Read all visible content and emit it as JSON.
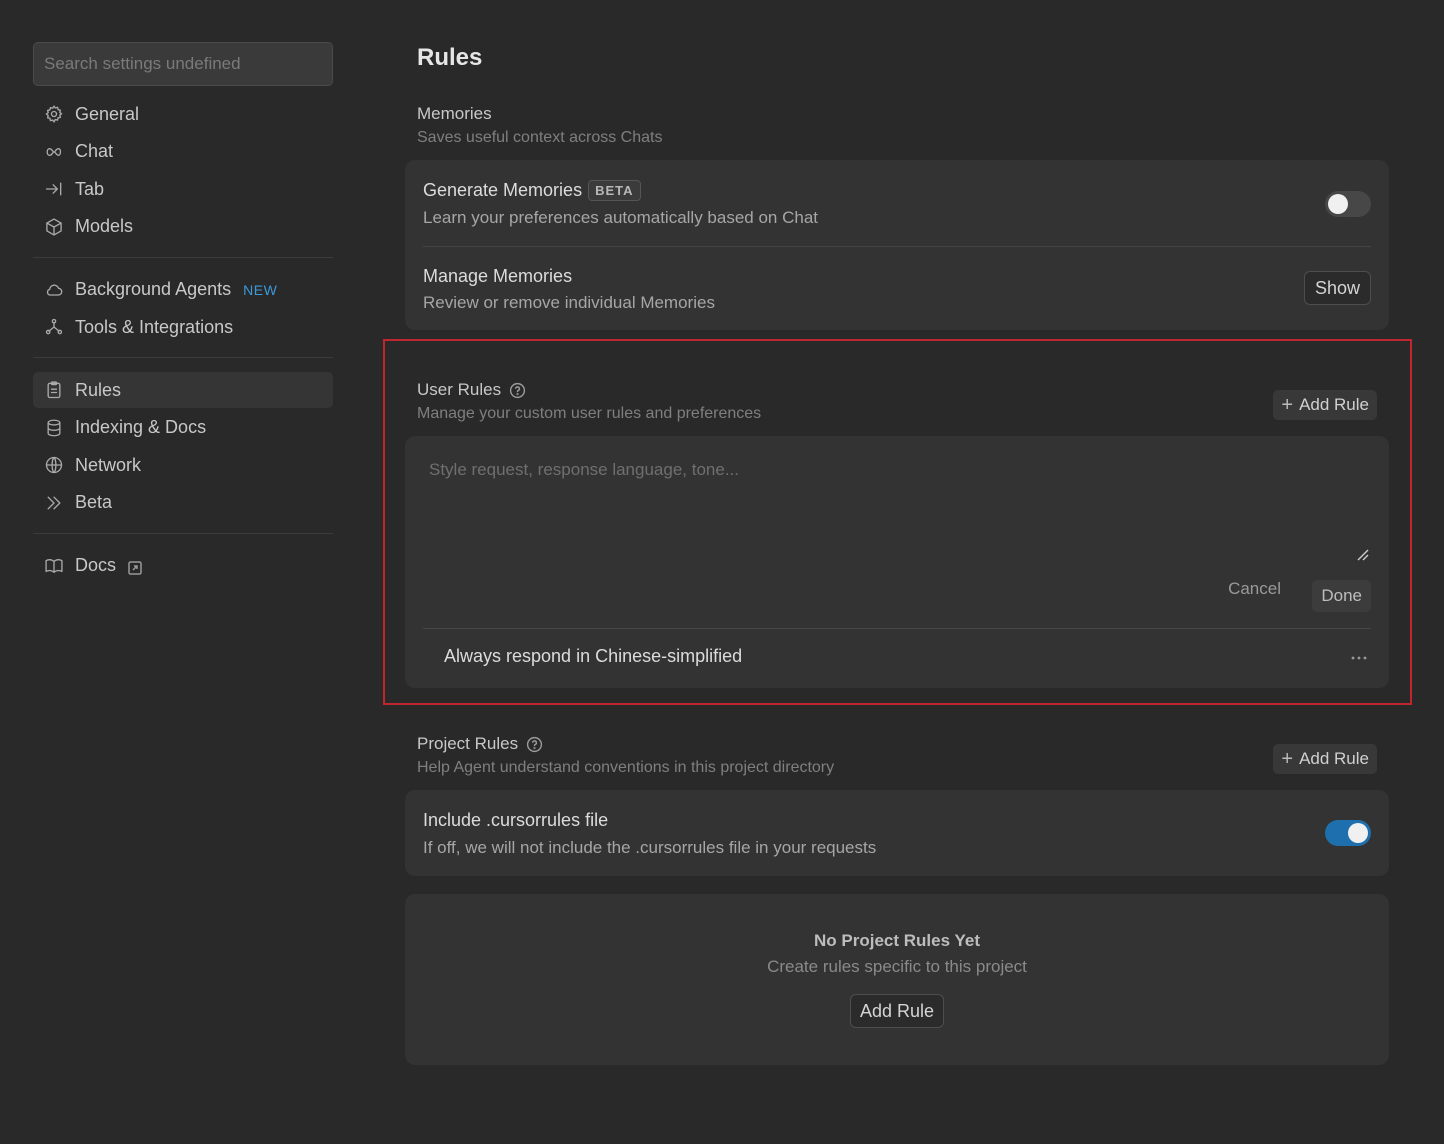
{
  "sidebar": {
    "search_placeholder": "Search settings undefined",
    "groups": [
      [
        {
          "label": "General",
          "icon": "gear-icon"
        },
        {
          "label": "Chat",
          "icon": "infinity-icon"
        },
        {
          "label": "Tab",
          "icon": "arrow-right-to-bar-icon"
        },
        {
          "label": "Models",
          "icon": "cube-icon"
        }
      ],
      [
        {
          "label": "Background Agents",
          "icon": "cloud-icon",
          "badge": "NEW"
        },
        {
          "label": "Tools & Integrations",
          "icon": "nodes-icon"
        }
      ],
      [
        {
          "label": "Rules",
          "icon": "clipboard-icon",
          "active": true
        },
        {
          "label": "Indexing & Docs",
          "icon": "database-icon"
        },
        {
          "label": "Network",
          "icon": "globe-icon"
        },
        {
          "label": "Beta",
          "icon": "double-chevron-icon"
        }
      ],
      [
        {
          "label": "Docs",
          "icon": "book-icon",
          "external": true
        }
      ]
    ]
  },
  "main": {
    "title": "Rules",
    "memories": {
      "title": "Memories",
      "subtitle": "Saves useful context across Chats",
      "generate": {
        "title": "Generate Memories",
        "badge": "BETA",
        "subtitle": "Learn your preferences automatically based on Chat",
        "enabled": false
      },
      "manage": {
        "title": "Manage Memories",
        "subtitle": "Review or remove individual Memories",
        "button": "Show"
      }
    },
    "user_rules": {
      "title": "User Rules",
      "subtitle": "Manage your custom user rules and preferences",
      "add_button": "Add Rule",
      "input_placeholder": "Style request, response language, tone...",
      "cancel": "Cancel",
      "done": "Done",
      "rules": [
        "Always respond in Chinese-simplified"
      ]
    },
    "project_rules": {
      "title": "Project Rules",
      "subtitle": "Help Agent understand conventions in this project directory",
      "add_button": "Add Rule",
      "cursorrules": {
        "title": "Include .cursorrules file",
        "subtitle": "If off, we will not include the .cursorrules file in your requests",
        "enabled": true
      },
      "empty": {
        "title": "No Project Rules Yet",
        "subtitle": "Create rules specific to this project",
        "button": "Add Rule"
      }
    }
  },
  "colors": {
    "background": "#292929",
    "card": "#333333",
    "accent": "#1e6fad",
    "new_badge": "#3b9ad9",
    "highlight": "#c0262d"
  }
}
